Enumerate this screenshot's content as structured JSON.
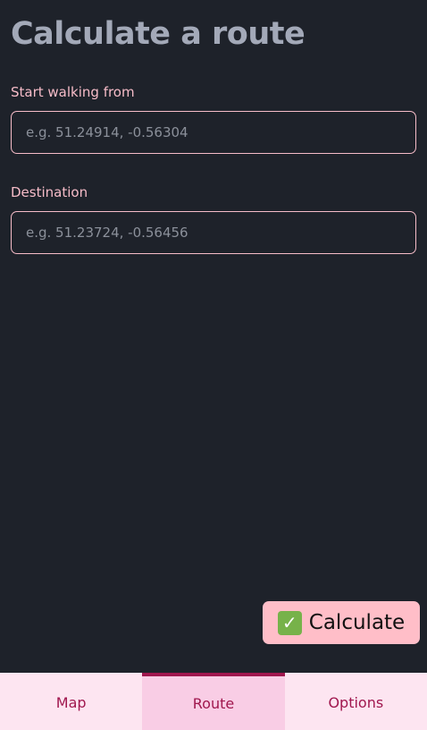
{
  "page": {
    "title": "Calculate a route"
  },
  "form": {
    "start": {
      "label": "Start walking from",
      "placeholder": "e.g. 51.24914, -0.56304",
      "value": ""
    },
    "destination": {
      "label": "Destination",
      "placeholder": "e.g. 51.23724, -0.56456",
      "value": ""
    },
    "calculate": {
      "icon": "check-mark-icon",
      "icon_glyph": "✓",
      "label": "Calculate"
    }
  },
  "nav": {
    "active": "Route",
    "tabs": [
      {
        "label": "Map"
      },
      {
        "label": "Route"
      },
      {
        "label": "Options"
      }
    ]
  },
  "colors": {
    "background": "#1e222a",
    "accent": "#f6bcc8",
    "button": "#ffbec8",
    "tab_text": "#a0174e",
    "tab_bg": "#fde5f1",
    "tab_active_bg": "#f9cde5"
  }
}
